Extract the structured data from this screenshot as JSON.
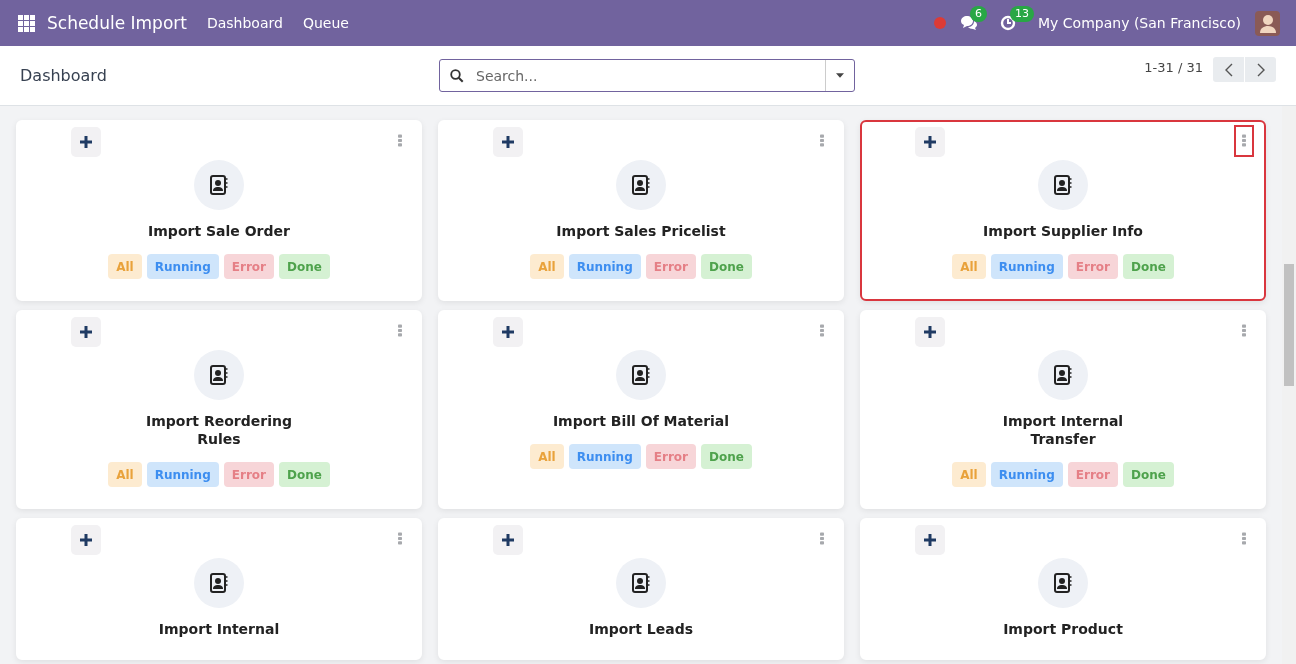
{
  "navbar": {
    "app_name": "Schedule Import",
    "menu": [
      "Dashboard",
      "Queue"
    ],
    "messages_count": "6",
    "activities_count": "13",
    "company": "My Company (San Francisco)"
  },
  "control_panel": {
    "breadcrumb": "Dashboard",
    "search": {
      "placeholder": "Search..."
    },
    "pager": "1-31 / 31"
  },
  "cards": [
    {
      "title": "Import Sale Order",
      "highlighted": false,
      "menu_highlighted": false,
      "filters": [
        {
          "label": "All",
          "kind": "all"
        },
        {
          "label": "Running",
          "kind": "running"
        },
        {
          "label": "Error",
          "kind": "error"
        },
        {
          "label": "Done",
          "kind": "done"
        }
      ]
    },
    {
      "title": "Import Sales Pricelist",
      "highlighted": false,
      "menu_highlighted": false,
      "filters": [
        {
          "label": "All",
          "kind": "all"
        },
        {
          "label": "Running",
          "kind": "running"
        },
        {
          "label": "Error",
          "kind": "error"
        },
        {
          "label": "Done",
          "kind": "done"
        }
      ]
    },
    {
      "title": "Import Supplier Info",
      "highlighted": true,
      "menu_highlighted": true,
      "filters": [
        {
          "label": "All",
          "kind": "all"
        },
        {
          "label": "Running",
          "kind": "running"
        },
        {
          "label": "Error",
          "kind": "error"
        },
        {
          "label": "Done",
          "kind": "done"
        }
      ]
    },
    {
      "title": "Import Reordering Rules",
      "highlighted": false,
      "menu_highlighted": false,
      "filters": [
        {
          "label": "All",
          "kind": "all"
        },
        {
          "label": "Running",
          "kind": "running"
        },
        {
          "label": "Error",
          "kind": "error"
        },
        {
          "label": "Done",
          "kind": "done"
        }
      ]
    },
    {
      "title": "Import Bill Of Material",
      "highlighted": false,
      "menu_highlighted": false,
      "filters": [
        {
          "label": "All",
          "kind": "all"
        },
        {
          "label": "Running",
          "kind": "running"
        },
        {
          "label": "Error",
          "kind": "error"
        },
        {
          "label": "Done",
          "kind": "done"
        }
      ]
    },
    {
      "title": "Import Internal Transfer",
      "highlighted": false,
      "menu_highlighted": false,
      "filters": [
        {
          "label": "All",
          "kind": "all"
        },
        {
          "label": "Running",
          "kind": "running"
        },
        {
          "label": "Error",
          "kind": "error"
        },
        {
          "label": "Done",
          "kind": "done"
        }
      ]
    },
    {
      "title": "Import Internal",
      "highlighted": false,
      "menu_highlighted": false
    },
    {
      "title": "Import Leads",
      "highlighted": false,
      "menu_highlighted": false
    },
    {
      "title": "Import Product",
      "highlighted": false,
      "menu_highlighted": false
    }
  ]
}
